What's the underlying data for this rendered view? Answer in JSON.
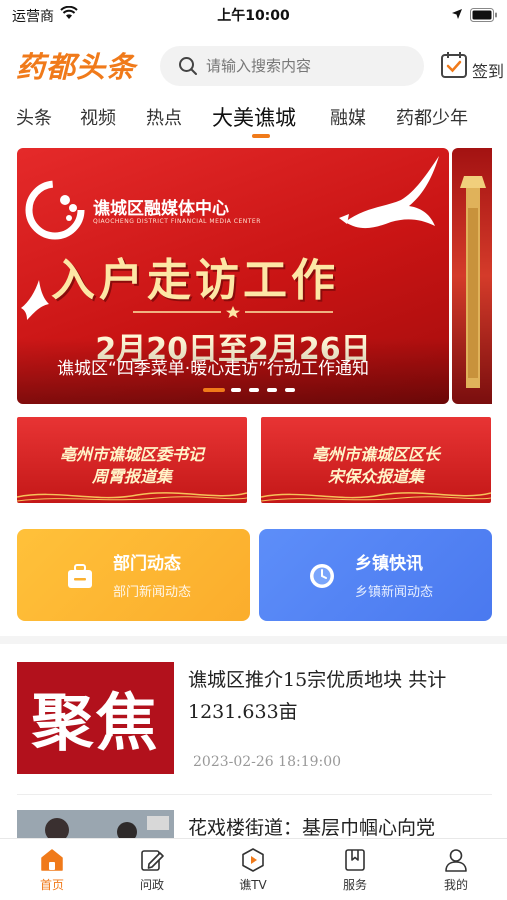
{
  "status_bar": {
    "carrier": "运营商",
    "time": "上午10:00"
  },
  "header": {
    "logo": "药都头条",
    "search_placeholder": "请输入搜索内容",
    "signin_label": "签到"
  },
  "tabs": [
    {
      "label": "头条"
    },
    {
      "label": "视频"
    },
    {
      "label": "热点"
    },
    {
      "label": "大美谯城",
      "active": true
    },
    {
      "label": "融媒"
    },
    {
      "label": "药都少年"
    }
  ],
  "banner": {
    "org_name": "谯城区融媒体中心",
    "org_name_en": "QIAOCHENG DISTRICT FINANCIAL MEDIA CENTER",
    "headline": "入户走访工作",
    "dates": "2月20日至2月26日",
    "caption": "谯城区“四季菜单·暖心走访”行动工作通知",
    "slide_count": 5,
    "active_slide": 1
  },
  "report_cards": [
    {
      "line1": "亳州市谯城区委书记",
      "line2": "周霄报道集"
    },
    {
      "line1": "亳州市谯城区区长",
      "line2": "宋保众报道集"
    }
  ],
  "quick_cards": [
    {
      "title": "部门动态",
      "subtitle": "部门新闻动态",
      "icon": "briefcase-icon",
      "color": "#fbb030"
    },
    {
      "title": "乡镇快讯",
      "subtitle": "乡镇新闻动态",
      "icon": "clock-icon",
      "color": "#5486f5"
    }
  ],
  "news": [
    {
      "thumb_text": "聚焦",
      "title": "谯城区推介15宗优质地块 共计1231.633亩",
      "time": "2023-02-26 18:19:00"
    },
    {
      "title": "花戏楼街道：基层巾帼心向党"
    }
  ],
  "bottom_nav": [
    {
      "label": "首页",
      "icon": "home-icon",
      "active": true
    },
    {
      "label": "问政",
      "icon": "edit-icon"
    },
    {
      "label": "谯TV",
      "icon": "tv-icon"
    },
    {
      "label": "服务",
      "icon": "bookmark-icon"
    },
    {
      "label": "我的",
      "icon": "user-icon"
    }
  ],
  "colors": {
    "accent": "#f07a1a",
    "banner_red": "#d21c1c"
  }
}
